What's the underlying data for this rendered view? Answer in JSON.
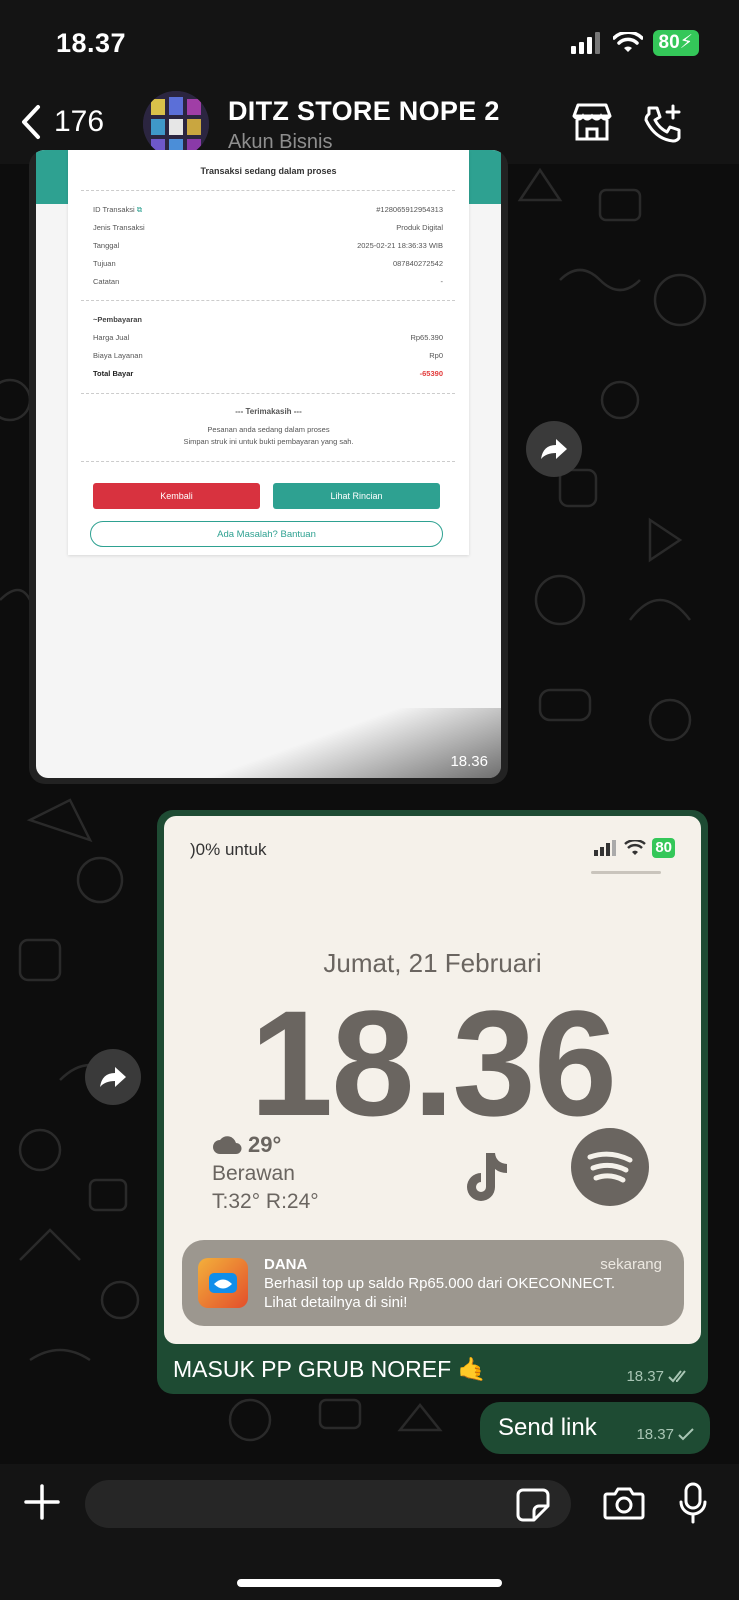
{
  "status_bar": {
    "time": "18.37",
    "battery": "80"
  },
  "header": {
    "back_count": "176",
    "title": "DITZ STORE NOPE 2",
    "subtitle": "Akun Bisnis"
  },
  "message_1": {
    "type": "image",
    "time": "18.36",
    "receipt": {
      "status": "Transaksi sedang dalam proses",
      "rows": [
        {
          "label": "ID Transaksi",
          "value": "#128065912954313"
        },
        {
          "label": "Jenis Transaksi",
          "value": "Produk Digital"
        },
        {
          "label": "Tanggal",
          "value": "2025-02-21 18:36:33 WIB"
        },
        {
          "label": "Tujuan",
          "value": "087840272542"
        },
        {
          "label": "Catatan",
          "value": "-"
        }
      ],
      "payment_title": "~Pembayaran",
      "payment_rows": [
        {
          "label": "Harga Jual",
          "value": "Rp65.390"
        },
        {
          "label": "Biaya Layanan",
          "value": "Rp0"
        }
      ],
      "total": {
        "label": "Total Bayar",
        "value": "-65390"
      },
      "thanks": "--- Terimakasih ---",
      "note_line1": "Pesanan anda sedang dalam proses",
      "note_line2": "Simpan struk ini untuk bukti pembayaran yang sah.",
      "btn_back": "Kembali",
      "btn_detail": "Lihat Rincian",
      "btn_help": "Ada Masalah? Bantuan"
    }
  },
  "message_2": {
    "type": "image",
    "lock_screen": {
      "carrier": ")0% untuk",
      "battery": "80",
      "date": "Jumat, 21 Februari",
      "clock": "18.36",
      "temp": "29°",
      "condition": "Berawan",
      "range": "T:32° R:24°",
      "notification": {
        "app": "DANA",
        "when": "sekarang",
        "line1": "Berhasil top up saldo Rp65.000 dari OKECONNECT.",
        "line2": "Lihat detailnya di sini!"
      }
    },
    "caption": "MASUK PP GRUB NOREF 🤙",
    "time": "18.37"
  },
  "message_3": {
    "type": "text",
    "text": "Send link",
    "time": "18.37"
  },
  "composer": {
    "placeholder": ""
  },
  "colors": {
    "outgoing_bubble": "#1e4b33",
    "teal": "#2ea191",
    "red": "#d8323f",
    "battery_green": "#34c759"
  }
}
